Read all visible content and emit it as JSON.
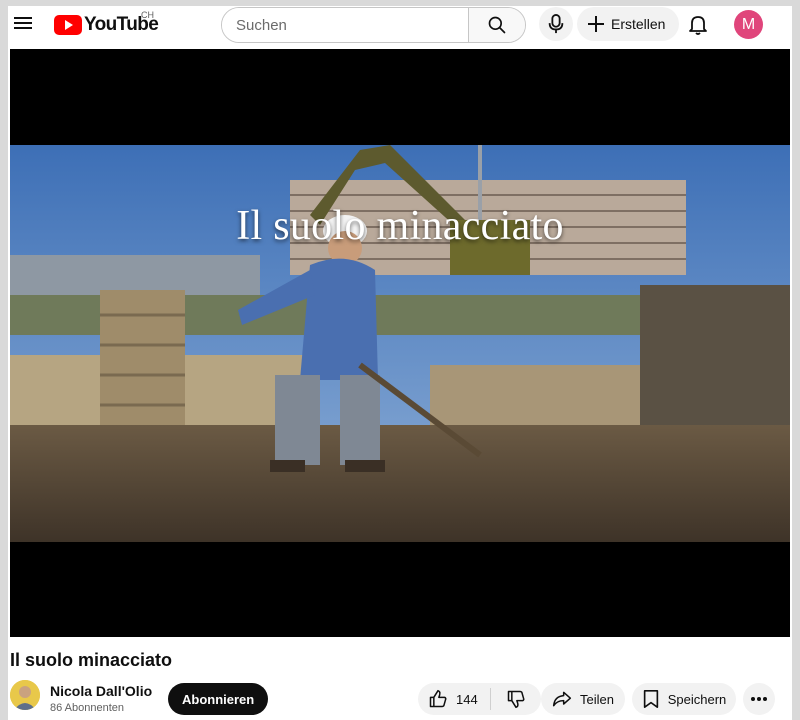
{
  "header": {
    "logo_text": "YouTube",
    "country_code": "CH",
    "search_placeholder": "Suchen",
    "create_label": "Erstellen",
    "avatar_letter": "M",
    "avatar_color": "#e0457b"
  },
  "player": {
    "overlay_caption": "Il suolo minacciato"
  },
  "video": {
    "title": "Il suolo minacciato",
    "channel_name": "Nicola Dall'Olio",
    "subscribers": "86 Abonnenten",
    "subscribe_label": "Abonnieren",
    "like_count": "144",
    "share_label": "Teilen",
    "save_label": "Speichern"
  },
  "icons": [
    "menu-icon",
    "youtube-play-icon",
    "search-icon",
    "mic-icon",
    "plus-icon",
    "bell-icon",
    "thumbs-up-icon",
    "thumbs-down-icon",
    "share-icon",
    "bookmark-icon",
    "more-icon"
  ],
  "colors": {
    "brand_red": "#ff0000",
    "subscribe_bg": "#0f0f0f",
    "pill_bg": "#f2f2f2"
  }
}
